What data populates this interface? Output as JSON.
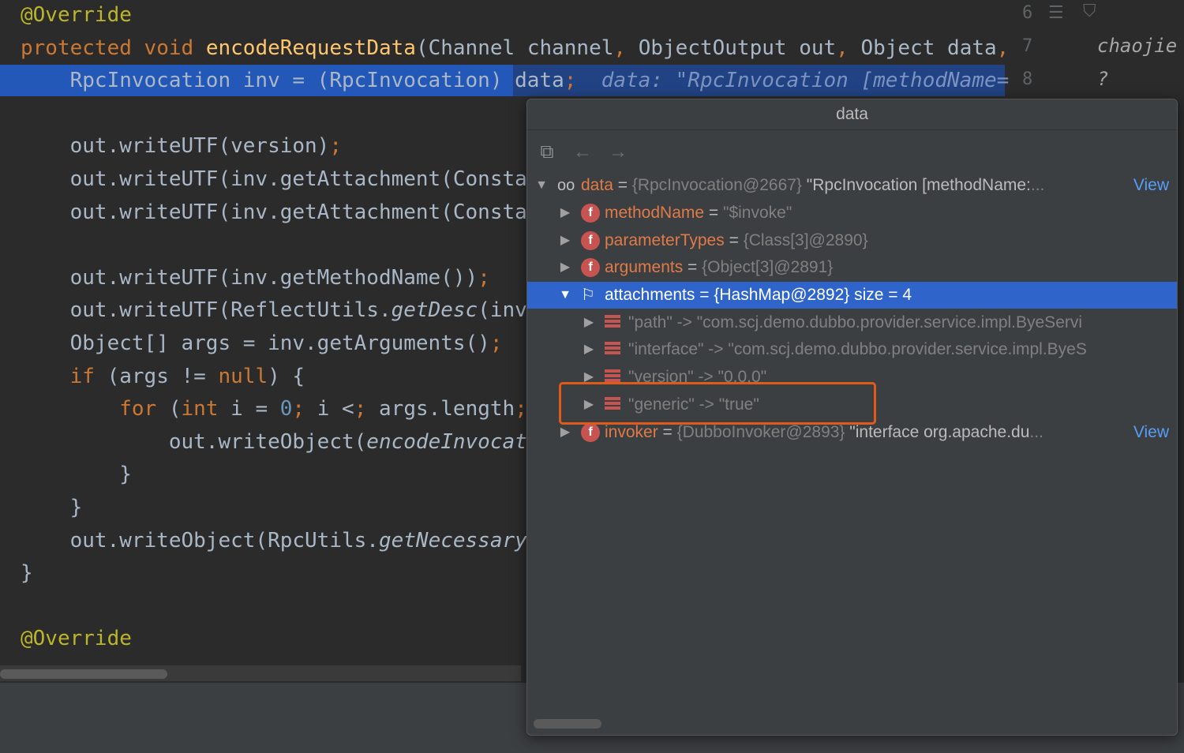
{
  "editor": {
    "lines": [
      {
        "text": "@Override",
        "cls": "ann"
      },
      {
        "text": "protected void encodeRequestData(Channel channel, ObjectOutput out, Object data,"
      },
      {
        "text": "    RpcInvocation inv = (RpcInvocation) data;"
      },
      {
        "text": ""
      },
      {
        "text": "    out.writeUTF(version);"
      },
      {
        "text": "    out.writeUTF(inv.getAttachment(Consta"
      },
      {
        "text": "    out.writeUTF(inv.getAttachment(Consta"
      },
      {
        "text": ""
      },
      {
        "text": "    out.writeUTF(inv.getMethodName());"
      },
      {
        "text": "    out.writeUTF(ReflectUtils.getDesc(inv"
      },
      {
        "text": "    Object[] args = inv.getArguments();"
      },
      {
        "text": "    if (args != null) {"
      },
      {
        "text": "        for (int i = 0; i < args.length;"
      },
      {
        "text": "            out.writeObject(encodeInvocat"
      },
      {
        "text": "        }"
      },
      {
        "text": "    }"
      },
      {
        "text": "    out.writeObject(RpcUtils.getNecessary"
      },
      {
        "text": "}"
      },
      {
        "text": ""
      },
      {
        "text": "@Override"
      }
    ],
    "inline_hint": "data: \"RpcInvocation [methodName=",
    "line_numbers": [
      "6",
      "7",
      "8"
    ],
    "author_fragment": "chaojie",
    "author_fragment2": "?"
  },
  "popup": {
    "title": "data",
    "toolbar": {
      "icons": [
        "watches-icon",
        "back-arrow-icon",
        "forward-arrow-icon"
      ]
    },
    "tree": [
      {
        "depth": 0,
        "expanded": true,
        "icon": "watch",
        "name": "data",
        "sep": " = ",
        "ref": "{RpcInvocation@2667}",
        "value": " \"RpcInvocation [methodName:",
        "ellipsis": "...",
        "link": "View"
      },
      {
        "depth": 1,
        "expanded": false,
        "icon": "field",
        "name": "methodName",
        "sep": " = ",
        "ref": "",
        "value": "\"$invoke\""
      },
      {
        "depth": 1,
        "expanded": false,
        "icon": "field",
        "name": "parameterTypes",
        "sep": " = ",
        "ref": "{Class[3]@2890}",
        "value": ""
      },
      {
        "depth": 1,
        "expanded": false,
        "icon": "field",
        "name": "arguments",
        "sep": " = ",
        "ref": "{Object[3]@2891}",
        "value": ""
      },
      {
        "depth": 1,
        "expanded": true,
        "icon": "flag",
        "name": "attachments",
        "sep": " = ",
        "ref": "{HashMap@2892}",
        "value": "  size = 4",
        "selected": true
      },
      {
        "depth": 2,
        "expanded": false,
        "icon": "map",
        "name": "\"path\" -> \"com.scj.demo.dubbo.provider.service.impl.ByeServi",
        "sep": "",
        "ref": "",
        "value": ""
      },
      {
        "depth": 2,
        "expanded": false,
        "icon": "map",
        "name": "\"interface\" -> \"com.scj.demo.dubbo.provider.service.impl.ByeS",
        "sep": "",
        "ref": "",
        "value": ""
      },
      {
        "depth": 2,
        "expanded": false,
        "icon": "map",
        "name": "\"version\" -> \"0.0.0\"",
        "sep": "",
        "ref": "",
        "value": ""
      },
      {
        "depth": 2,
        "expanded": false,
        "icon": "map",
        "name": "\"generic\" -> \"true\"",
        "sep": "",
        "ref": "",
        "value": ""
      },
      {
        "depth": 1,
        "expanded": false,
        "icon": "field",
        "name": "invoker",
        "sep": " = ",
        "ref": "{DubboInvoker@2893}",
        "value": " \"interface org.apache.du",
        "ellipsis": "...",
        "link": "View"
      }
    ]
  }
}
